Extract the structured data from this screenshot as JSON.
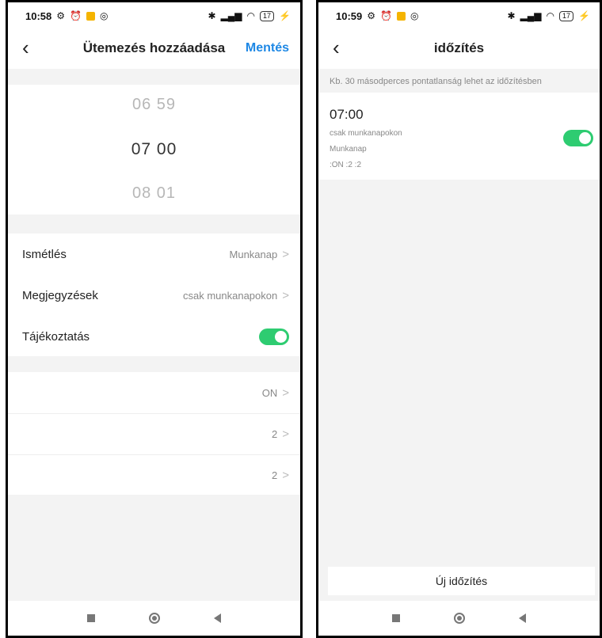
{
  "left": {
    "status_time": "10:58",
    "battery": "17",
    "title": "Ütemezés hozzáadása",
    "save_label": "Mentés",
    "picker": {
      "prev": "06  59",
      "selected": "07  00",
      "next": "08  01"
    },
    "settings": [
      {
        "label": "Ismétlés",
        "value": "Munkanap"
      },
      {
        "label": "Megjegyzések",
        "value": "csak munkanapokon"
      }
    ],
    "notify": {
      "label": "Tájékoztatás",
      "enabled": true
    },
    "extras": [
      "ON",
      "2",
      "2"
    ]
  },
  "right": {
    "status_time": "10:59",
    "battery": "17",
    "title": "időzítés",
    "note": "Kb. 30 másodperces pontatlanság lehet az időzítésben",
    "timer": {
      "time": "07:00",
      "remark": "csak munkanapokon",
      "repeat": "Munkanap",
      "actions": ":ON :2 :2",
      "enabled": true
    },
    "new_button": "Új időzítés"
  },
  "colors": {
    "accent": "#1e88e5",
    "toggle_on": "#2ecc71"
  }
}
